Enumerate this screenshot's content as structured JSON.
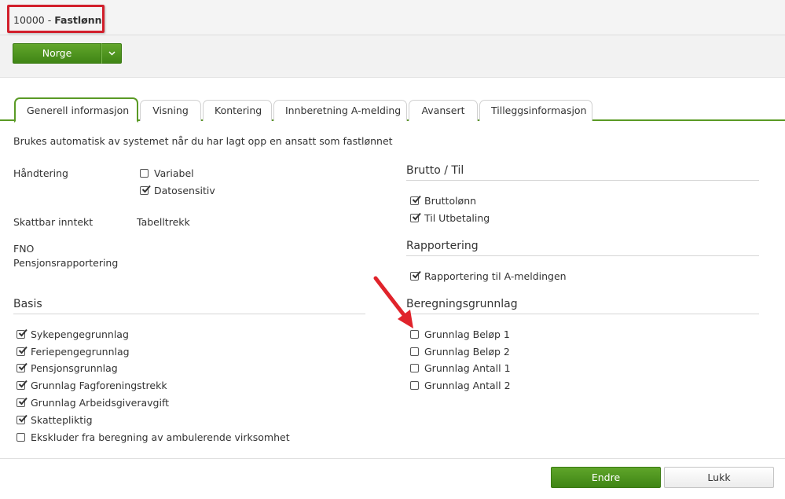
{
  "header": {
    "code": "10000",
    "separator": " - ",
    "name": "Fastlønn",
    "country_button": "Norge"
  },
  "tabs": [
    {
      "label": "Generell informasjon",
      "active": true
    },
    {
      "label": "Visning",
      "active": false
    },
    {
      "label": "Kontering",
      "active": false
    },
    {
      "label": "Innberetning A-melding",
      "active": false
    },
    {
      "label": "Avansert",
      "active": false
    },
    {
      "label": "Tilleggsinformasjon",
      "active": false
    }
  ],
  "description": "Brukes automatisk av systemet når du har lagt opp en ansatt som fastlønnet",
  "left": {
    "handtering_label": "Håndtering",
    "handtering_options": [
      {
        "label": "Variabel",
        "checked": false
      },
      {
        "label": "Datosensitiv",
        "checked": true
      }
    ],
    "skattbar_label": "Skattbar inntekt",
    "skattbar_value": "Tabelltrekk",
    "fno_label": "FNO",
    "pensjon_label": "Pensjonsrapportering",
    "basis_title": "Basis",
    "basis_items": [
      {
        "label": "Sykepengegrunnlag",
        "checked": true
      },
      {
        "label": "Feriepengegrunnlag",
        "checked": true
      },
      {
        "label": "Pensjonsgrunnlag",
        "checked": true
      },
      {
        "label": "Grunnlag Fagforeningstrekk",
        "checked": true
      },
      {
        "label": "Grunnlag Arbeidsgiveravgift",
        "checked": true
      },
      {
        "label": "Skattepliktig",
        "checked": true
      },
      {
        "label": "Ekskluder fra beregning av ambulerende virksomhet",
        "checked": false
      }
    ]
  },
  "right": {
    "brutto_title": "Brutto / Til",
    "brutto_items": [
      {
        "label": "Bruttolønn",
        "checked": true
      },
      {
        "label": "Til Utbetaling",
        "checked": true
      }
    ],
    "rapportering_title": "Rapportering",
    "rapportering_items": [
      {
        "label": "Rapportering til A-meldingen",
        "checked": true
      }
    ],
    "beregning_title": "Beregningsgrunnlag",
    "beregning_items": [
      {
        "label": "Grunnlag Beløp 1",
        "checked": false
      },
      {
        "label": "Grunnlag Beløp 2",
        "checked": false
      },
      {
        "label": "Grunnlag Antall 1",
        "checked": false
      },
      {
        "label": "Grunnlag Antall 2",
        "checked": false
      }
    ]
  },
  "footer": {
    "primary_label": "Endre",
    "secondary_label": "Lukk"
  },
  "colors": {
    "accent_green": "#4a8f1c",
    "highlight_red": "#d21f2b"
  }
}
